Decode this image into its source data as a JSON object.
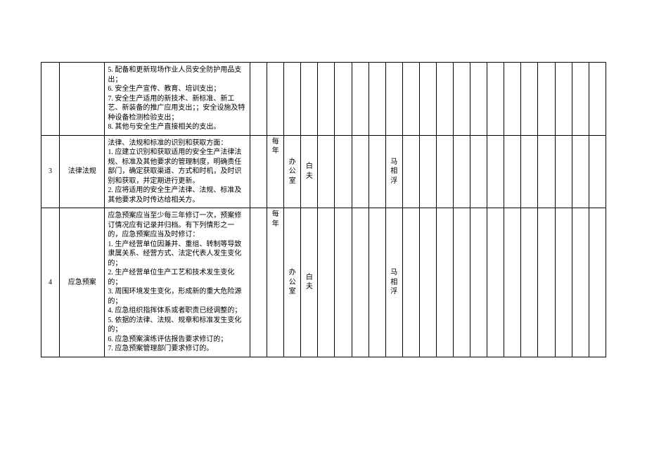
{
  "rows": [
    {
      "id": "",
      "title": "",
      "desc": "5. 配备和更新现场作业人员安全防护用品支出；\n6. 安全生产宣传、教育、培训支出；\n7. 安全生产适用的新技术、新标准、新工艺、新装备的推广应用支出；；安全设施及特种设备检测检验支出；\n8. 其他与安全生产直接相关的支出。",
      "freq": "",
      "dept": "",
      "person1": "",
      "person2": ""
    },
    {
      "id": "3",
      "title": "法律法规",
      "desc": "法律、法规和标准的识别和获取方面：\n1. 应建立识别和获取适用的安全生产法律法规、标准及其他要求的管理制度，明确责任部门，确定获取渠道、方式和时机，及时识别和获取，并定期进行更新。\n2. 应将适用的安全生产法律、法规、标准及其他要求及时传达给相关方。",
      "freq": "每年",
      "dept": "办公室",
      "person1": "白夫",
      "person2": "马相浮"
    },
    {
      "id": "4",
      "title": "应急预案",
      "desc": "应急预案应当至少每三年修订一次，预案修订情况应有记录并归档。有下列情形之一的，应急预案应当及时修订：\n1. 生产经营单位因兼并、重组、转制等导致隶属关系、经营方式、法定代表人发生变化的；\n2. 生产经营单位生产工艺和技术发生变化的；\n3. 周围环境发生变化，形成新的重大危险源的；\n4. 应急组织指挥体系或者职责已经调整的；\n5. 依据的法律、法规、规章和标准发生变化的；\n6. 应急预案演练评估报告要求修订的；\n7. 应急预案管理部门要求修订的。",
      "freq": "每年",
      "dept": "办公室",
      "person1": "白夫",
      "person2": "马相浮"
    }
  ]
}
